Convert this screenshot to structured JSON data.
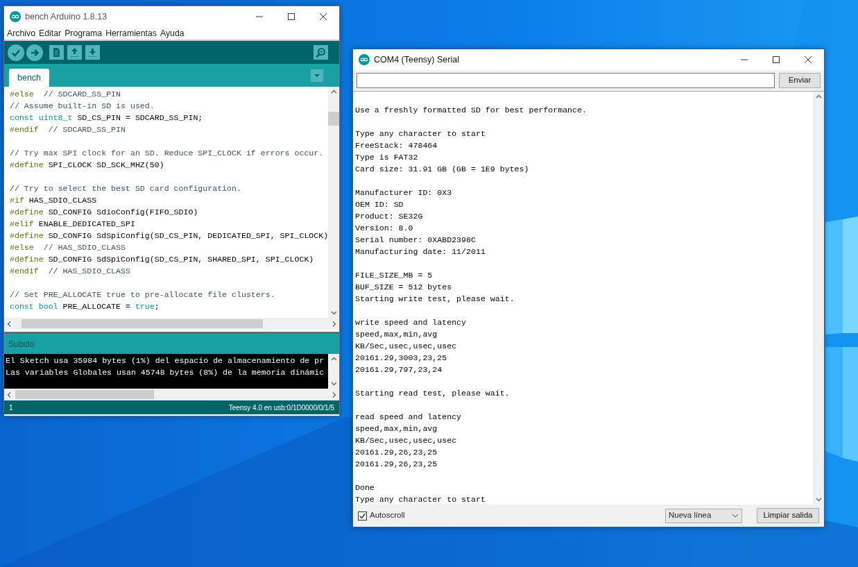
{
  "arduino_window": {
    "title": "bench Arduino 1.8.13",
    "menu": [
      "Archivo",
      "Editar",
      "Programa",
      "Herramientas",
      "Ayuda"
    ],
    "tabs": [
      {
        "label": "bench",
        "selected": true
      }
    ],
    "code_blocks": [
      [
        [
          {
            "kind": "directive",
            "text": "#else"
          },
          {
            "kind": "comment",
            "text": "  // SDCARD_SS_PIN"
          }
        ],
        [
          {
            "kind": "comment",
            "text": "// Assume built-in SD is used."
          }
        ],
        [
          {
            "kind": "keyword",
            "text": "const uint8_t"
          },
          {
            "kind": "plain",
            "text": " SD_CS_PIN = SDCARD_SS_PIN;"
          }
        ],
        [
          {
            "kind": "directive",
            "text": "#endif"
          },
          {
            "kind": "comment",
            "text": "  // SDCARD_SS_PIN"
          }
        ]
      ],
      [
        [
          {
            "kind": "comment",
            "text": "// Try max SPI clock for an SD. Reduce SPI_CLOCK if errors occur."
          }
        ],
        [
          {
            "kind": "directive",
            "text": "#define"
          },
          {
            "kind": "plain",
            "text": " SPI_CLOCK SD_SCK_MHZ(50)"
          }
        ]
      ],
      [
        [
          {
            "kind": "comment",
            "text": "// Try to select the best SD card configuration."
          }
        ],
        [
          {
            "kind": "directive",
            "text": "#if"
          },
          {
            "kind": "plain",
            "text": " HAS_SDIO_CLASS"
          }
        ],
        [
          {
            "kind": "directive",
            "text": "#define"
          },
          {
            "kind": "plain",
            "text": " SD_CONFIG SdioConfig(FIFO_SDIO)"
          }
        ],
        [
          {
            "kind": "directive",
            "text": "#elif"
          },
          {
            "kind": "plain",
            "text": " ENABLE_DEDICATED_SPI"
          }
        ],
        [
          {
            "kind": "directive",
            "text": "#define"
          },
          {
            "kind": "plain",
            "text": " SD_CONFIG SdSpiConfig(SD_CS_PIN, DEDICATED_SPI, SPI_CLOCK)"
          }
        ],
        [
          {
            "kind": "directive",
            "text": "#else"
          },
          {
            "kind": "comment",
            "text": "  // HAS_SDIO_CLASS"
          }
        ],
        [
          {
            "kind": "directive",
            "text": "#define"
          },
          {
            "kind": "plain",
            "text": " SD_CONFIG SdSpiConfig(SD_CS_PIN, SHARED_SPI, SPI_CLOCK)"
          }
        ],
        [
          {
            "kind": "directive",
            "text": "#endif"
          },
          {
            "kind": "comment",
            "text": "  // HAS_SDIO_CLASS"
          }
        ]
      ],
      [
        [
          {
            "kind": "comment",
            "text": "// Set PRE_ALLOCATE true to pre-allocate file clusters."
          }
        ],
        [
          {
            "kind": "keyword",
            "text": "const bool"
          },
          {
            "kind": "plain",
            "text": " PRE_ALLOCATE = "
          },
          {
            "kind": "keyword",
            "text": "true"
          },
          {
            "kind": "plain",
            "text": ";"
          }
        ]
      ]
    ],
    "status_label": "Subido",
    "console_lines": [
      "El Sketch usa 35984 bytes (1%) del espacio de almacenamiento de pr",
      "Las variables Globales usan 45748 bytes (8%) de la memoria dinámic"
    ],
    "status_bar": {
      "line": "1",
      "board": "Teensy 4.0 en usb:0/1D0000/0/1/5"
    }
  },
  "serial_window": {
    "title": "COM4 (Teensy) Serial",
    "send_button": "Enviar",
    "output_blocks": [
      [
        "Use a freshly formatted SD for best performance."
      ],
      [
        "Type any character to start",
        "FreeStack: 478464",
        "Type is FAT32",
        "Card size: 31.91 GB (GB = 1E9 bytes)"
      ],
      [
        "Manufacturer ID: 0X3",
        "OEM ID: SD",
        "Product: SE32G",
        "Version: 8.0",
        "Serial number: 0XABD2398C",
        "Manufacturing date: 11/2011"
      ],
      [
        "FILE_SIZE_MB = 5",
        "BUF_SIZE = 512 bytes",
        "Starting write test, please wait."
      ],
      [
        "write speed and latency",
        "speed,max,min,avg",
        "KB/Sec,usec,usec,usec",
        "20161.29,3003,23,25",
        "20161.29,797,23,24"
      ],
      [
        "Starting read test, please wait."
      ],
      [
        "read speed and latency",
        "speed,max,min,avg",
        "KB/Sec,usec,usec,usec",
        "20161.29,26,23,25",
        "20161.29,26,23,25"
      ],
      [
        "Done",
        "Type any character to start"
      ]
    ],
    "autoscroll": {
      "label": "Autoscroll",
      "checked": true
    },
    "line_ending": "Nueva línea",
    "clear_button": "Limpiar salida"
  }
}
